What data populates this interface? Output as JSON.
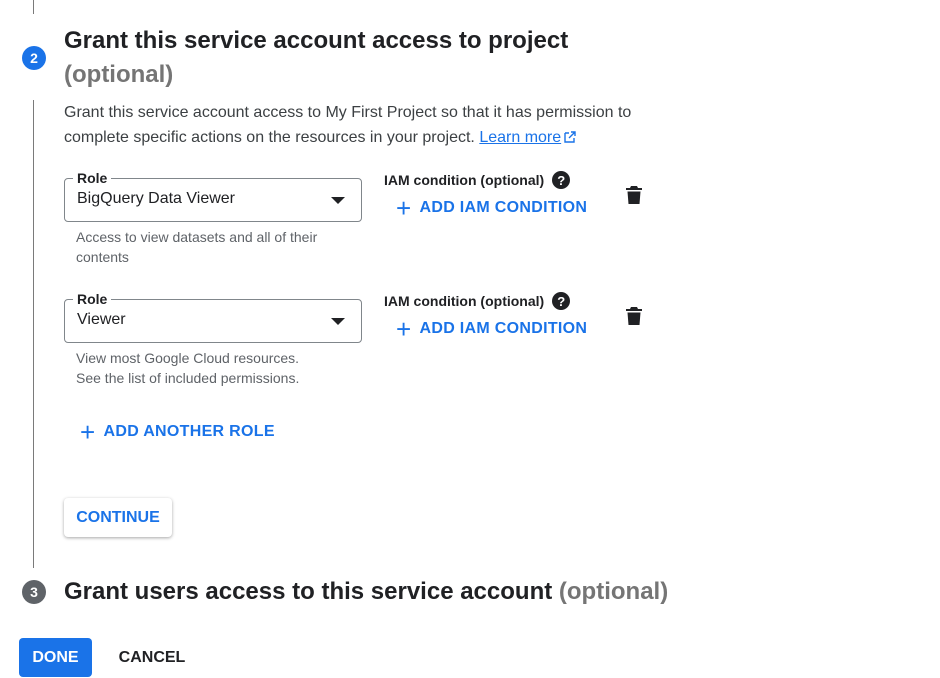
{
  "step2": {
    "number": "2",
    "title": "Grant this service account access to project",
    "optional": "(optional)",
    "description_line1": "Grant this service account access to My First Project so that it has permission to",
    "description_line2": "complete specific actions on the resources in your project.",
    "learn_more": "Learn more"
  },
  "roles": [
    {
      "label": "Role",
      "value": "BigQuery Data Viewer",
      "hint_line1": "Access to view datasets and all of their",
      "hint_line2": "contents",
      "iam_label": "IAM condition (optional)",
      "help": "?",
      "add_iam": "ADD IAM CONDITION",
      "delete_icon": "trash-icon"
    },
    {
      "label": "Role",
      "value": "Viewer",
      "hint_line1": "View most Google Cloud resources.",
      "hint_line2": "See the list of included permissions.",
      "iam_label": "IAM condition (optional)",
      "help": "?",
      "add_iam": "ADD IAM CONDITION",
      "delete_icon": "trash-icon"
    }
  ],
  "add_another_role": "ADD ANOTHER ROLE",
  "continue_label": "CONTINUE",
  "step3": {
    "number": "3",
    "title": "Grant users access to this service account",
    "optional": "(optional)"
  },
  "footer": {
    "done_label": "DONE",
    "cancel_label": "CANCEL"
  },
  "colors": {
    "accent": "#1a73e8",
    "step_active": "#1a73e8",
    "step_inactive": "#5f6368"
  }
}
